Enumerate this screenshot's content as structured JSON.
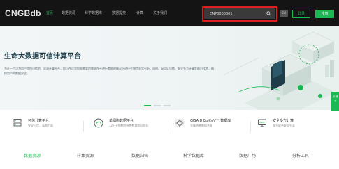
{
  "brand": {
    "logo": "CNGBdb"
  },
  "nav": {
    "items": [
      "首页",
      "数据资源",
      "科学数据库",
      "数据提交",
      "计算",
      "关于我们"
    ],
    "active_index": 0
  },
  "search": {
    "value": "CNP0000001"
  },
  "header": {
    "lang": "EN",
    "login": "登录",
    "register": "注册"
  },
  "hero": {
    "title": "生命大数据可信计算平台",
    "description": "为正一个可为用户提供可信的、资源计算平台，你可在这里根据需要的需求在不进行数据的情况下进行生物信息学分析，同时，采用区块链、安全多方计算等前沿技术，确保用户的数据安全。",
    "slides": 3,
    "active_slide": 0
  },
  "side_tab": {
    "label": "反馈"
  },
  "features": [
    {
      "icon": "server-icon",
      "title": "可信计算平台",
      "subtitle": "安全可信，高效扩展"
    },
    {
      "icon": "cloud-upload-icon",
      "title": "单细胞数据平台",
      "subtitle": "12万+细胞的细胞数据和可视化"
    },
    {
      "icon": "virus-icon",
      "title": "GISAID EpiCoV™ 数据库",
      "subtitle": "全球流感数据共享"
    },
    {
      "icon": "computer-icon",
      "title": "安全多方计算",
      "subtitle": "多方联合安全共享"
    }
  ],
  "tabs": {
    "items": [
      "数据资源",
      "样本资源",
      "数据归档",
      "科学数据库",
      "数据广场",
      "分析工具"
    ],
    "active_index": 0
  },
  "colors": {
    "accent": "#1bb954",
    "nav_bg": "#141414",
    "highlight": "#e11d1d",
    "hero_title": "#1f3d49"
  }
}
